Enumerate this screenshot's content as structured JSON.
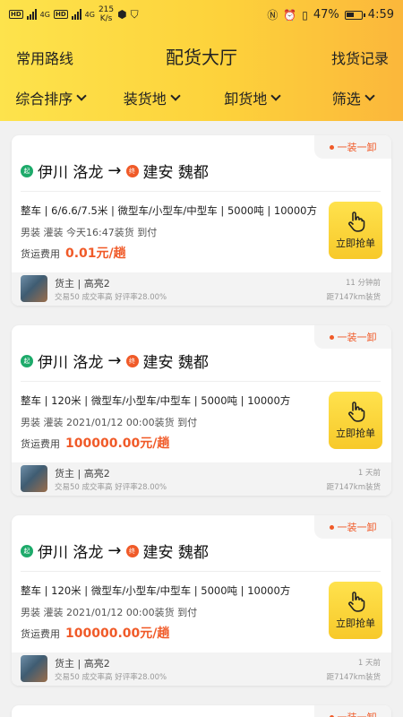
{
  "status_bar": {
    "network_left": "HD",
    "network_right": "HD",
    "signal_left": "4G",
    "signal_right": "4G",
    "speed_value": "215",
    "speed_unit": "K/s",
    "battery_percent": "47%",
    "time": "4:59"
  },
  "header": {
    "left_link": "常用路线",
    "title": "配货大厅",
    "right_link": "找货记录"
  },
  "filters": [
    {
      "label": "综合排序"
    },
    {
      "label": "装货地"
    },
    {
      "label": "卸货地"
    },
    {
      "label": "筛选"
    }
  ],
  "cards": [
    {
      "tag": "一装一卸",
      "start_badge": "起",
      "from": "伊川 洛龙",
      "arrow": "→",
      "end_badge": "终",
      "to": "建安 魏都",
      "spec": "整车 | 6/6.6/7.5米 | 微型车/小型车/中型车 | 5000吨 | 10000方",
      "meta": "男装  灌装  今天16:47装货  到付",
      "fee_label": "货运费用",
      "fee_value": "0.01元/趟",
      "grab_label": "立即抢单",
      "owner": "货主 | 高亮2",
      "stats": "交易50  成交率高  好评率28.00%",
      "ago": "11 分钟前",
      "distance": "距7147km装货"
    },
    {
      "tag": "一装一卸",
      "start_badge": "起",
      "from": "伊川 洛龙",
      "arrow": "→",
      "end_badge": "终",
      "to": "建安 魏都",
      "spec": "整车 | 120米 | 微型车/小型车/中型车 | 5000吨 | 10000方",
      "meta": "男装  灌装  2021/01/12 00:00装货  到付",
      "fee_label": "货运费用",
      "fee_value": "100000.00元/趟",
      "grab_label": "立即抢单",
      "owner": "货主 | 高亮2",
      "stats": "交易50  成交率高  好评率28.00%",
      "ago": "1 天前",
      "distance": "距7147km装货"
    },
    {
      "tag": "一装一卸",
      "start_badge": "起",
      "from": "伊川 洛龙",
      "arrow": "→",
      "end_badge": "终",
      "to": "建安 魏都",
      "spec": "整车 | 120米 | 微型车/小型车/中型车 | 5000吨 | 10000方",
      "meta": "男装  灌装  2021/01/12 00:00装货  到付",
      "fee_label": "货运费用",
      "fee_value": "100000.00元/趟",
      "grab_label": "立即抢单",
      "owner": "货主 | 高亮2",
      "stats": "交易50  成交率高  好评率28.00%",
      "ago": "1 天前",
      "distance": "距7147km装货"
    }
  ],
  "partial_card": {
    "tag": "一装一卸"
  },
  "colors": {
    "accent": "#f05a28",
    "header_start": "#fde34c",
    "header_end": "#fbb73b",
    "start_badge": "#1daa6a"
  }
}
